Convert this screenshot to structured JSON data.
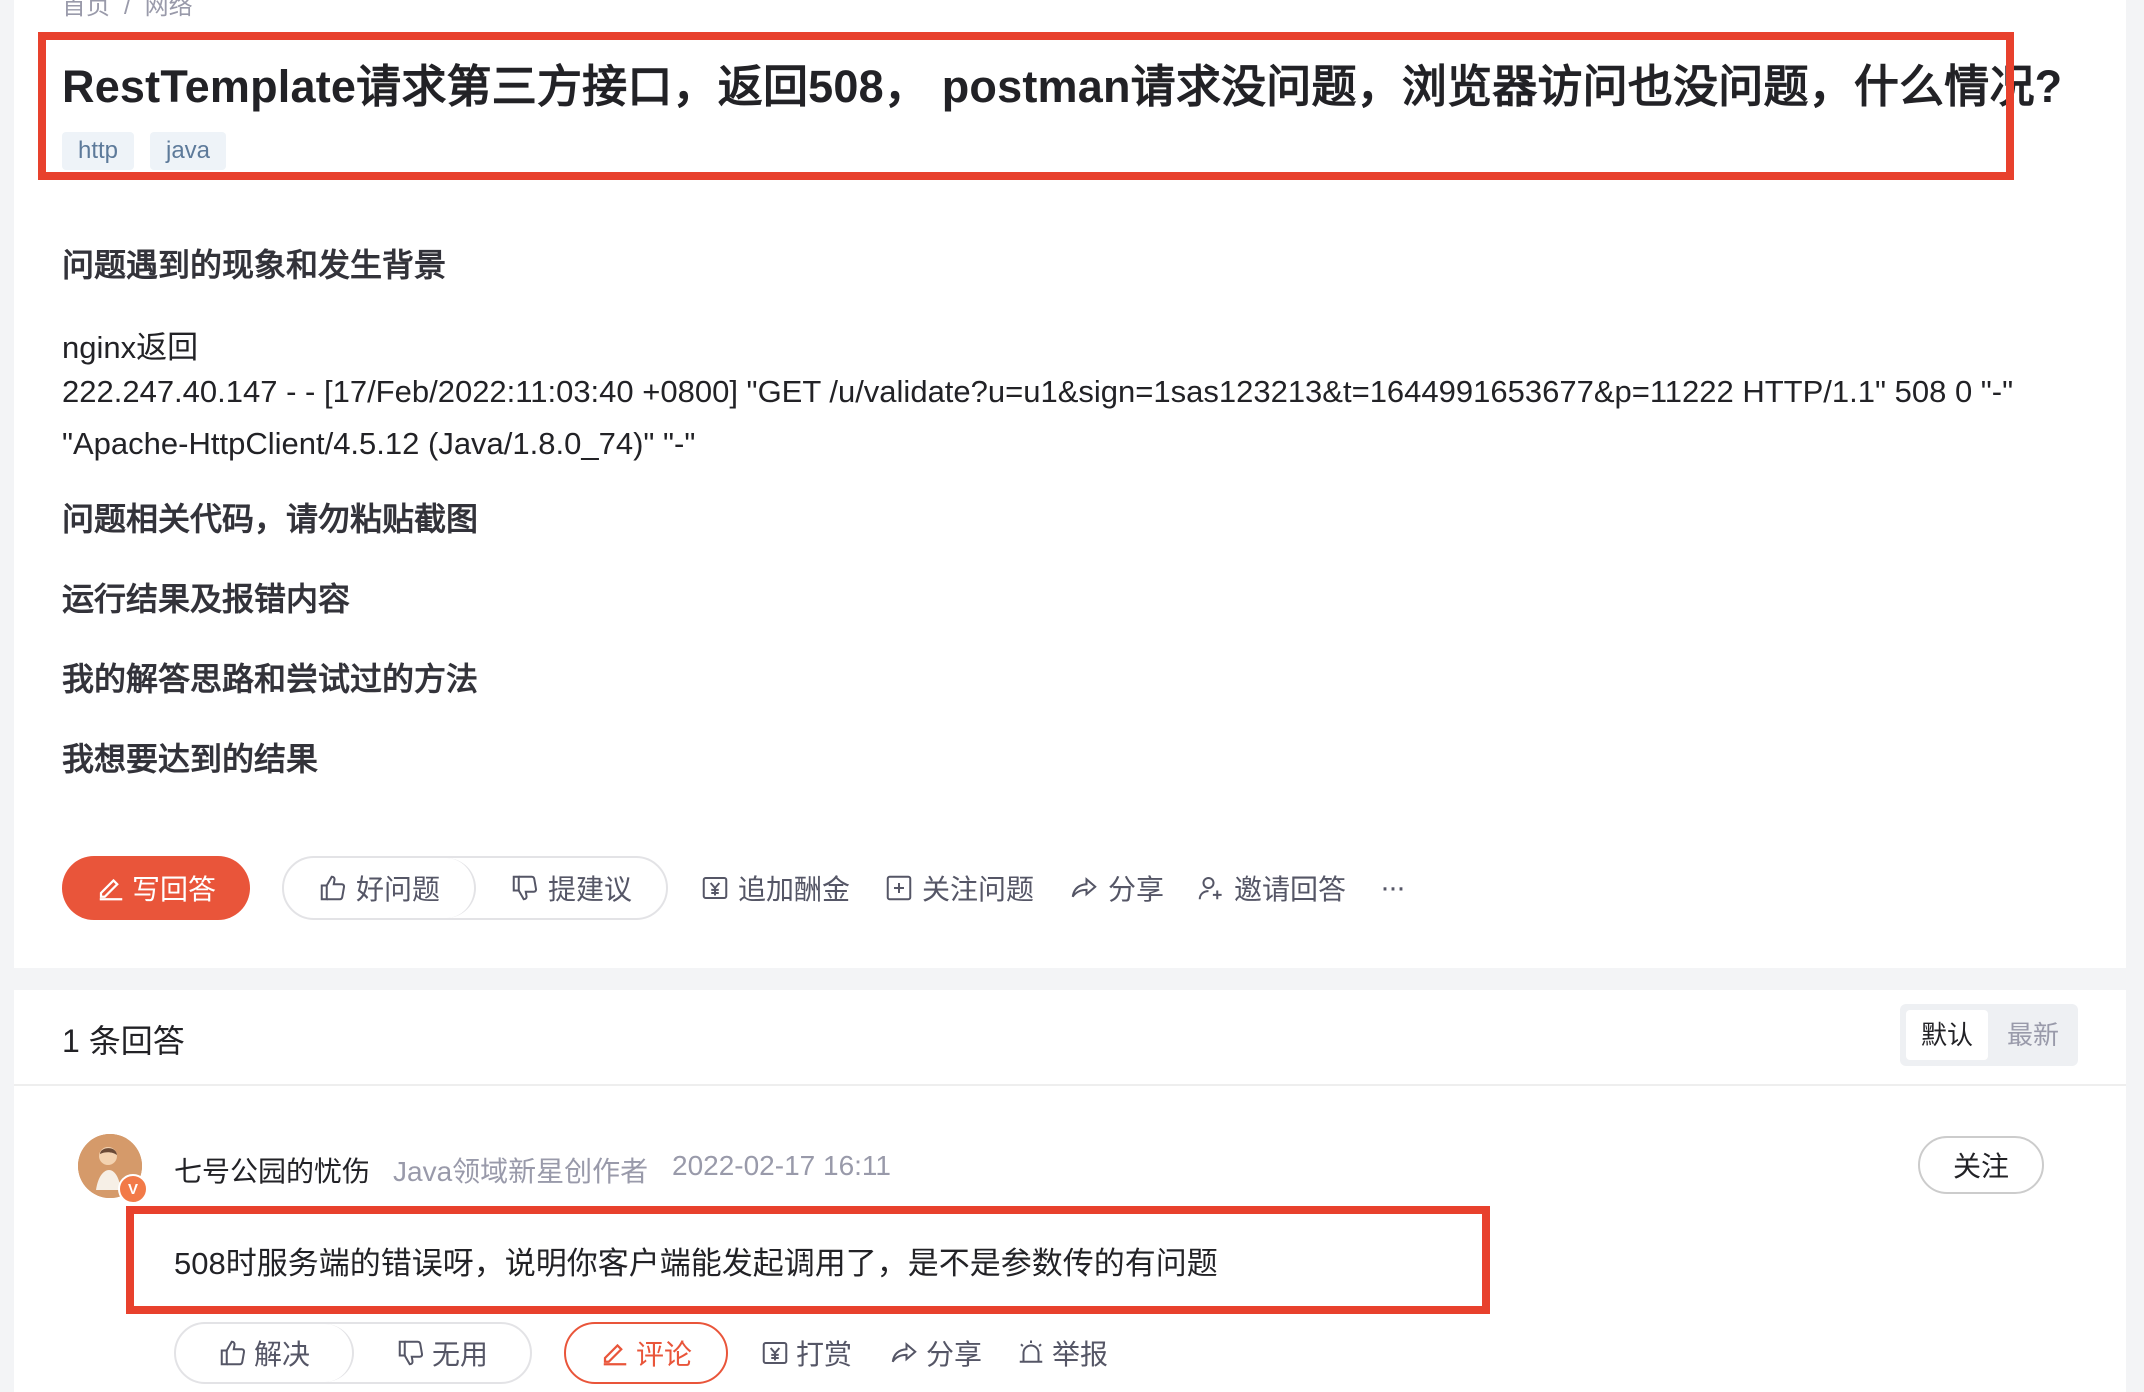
{
  "breadcrumb": {
    "home": "首页",
    "sep": "/",
    "current": "网络"
  },
  "question": {
    "title": "RestTemplate请求第三方接口，返回508， postman请求没问题，浏览器访问也没问题，什么情况?",
    "tags": [
      "http",
      "java"
    ],
    "section_phenomenon": "问题遇到的现象和发生背景",
    "nginx_label": "nginx返回",
    "log_line1": "222.247.40.147 - - [17/Feb/2022:11:03:40 +0800] \"GET /u/validate?u=u1&sign=1sas123213&t=1644991653677&p=11222 HTTP/1.1\" 508 0 \"-\"",
    "log_line2": "\"Apache-HttpClient/4.5.12 (Java/1.8.0_74)\" \"-\"",
    "section_code": "问题相关代码，请勿粘贴截图",
    "section_result": "运行结果及报错内容",
    "section_attempts": "我的解答思路和尝试过的方法",
    "section_goal": "我想要达到的结果"
  },
  "actions": {
    "write_answer": "写回答",
    "good_question": "好问题",
    "suggest": "提建议",
    "add_bounty": "追加酬金",
    "follow_question": "关注问题",
    "share": "分享",
    "invite": "邀请回答",
    "more": "···"
  },
  "answers": {
    "count_label": "1 条回答",
    "sort_default": "默认",
    "sort_latest": "最新",
    "items": [
      {
        "avatar_badge": "V",
        "username": "七号公园的忧伤",
        "user_title": "Java领域新星创作者",
        "time": "2022-02-17 16:11",
        "follow": "关注",
        "content": "508时服务端的错误呀，说明你客户端能发起调用了，是不是参数传的有问题",
        "resolve": "解决",
        "useless": "无用",
        "comment": "评论",
        "reward": "打赏",
        "share": "分享",
        "report": "举报"
      }
    ]
  },
  "colors": {
    "accent": "#e9553a",
    "highlight_box": "#e8412d",
    "tag_bg": "#eef3f8"
  }
}
